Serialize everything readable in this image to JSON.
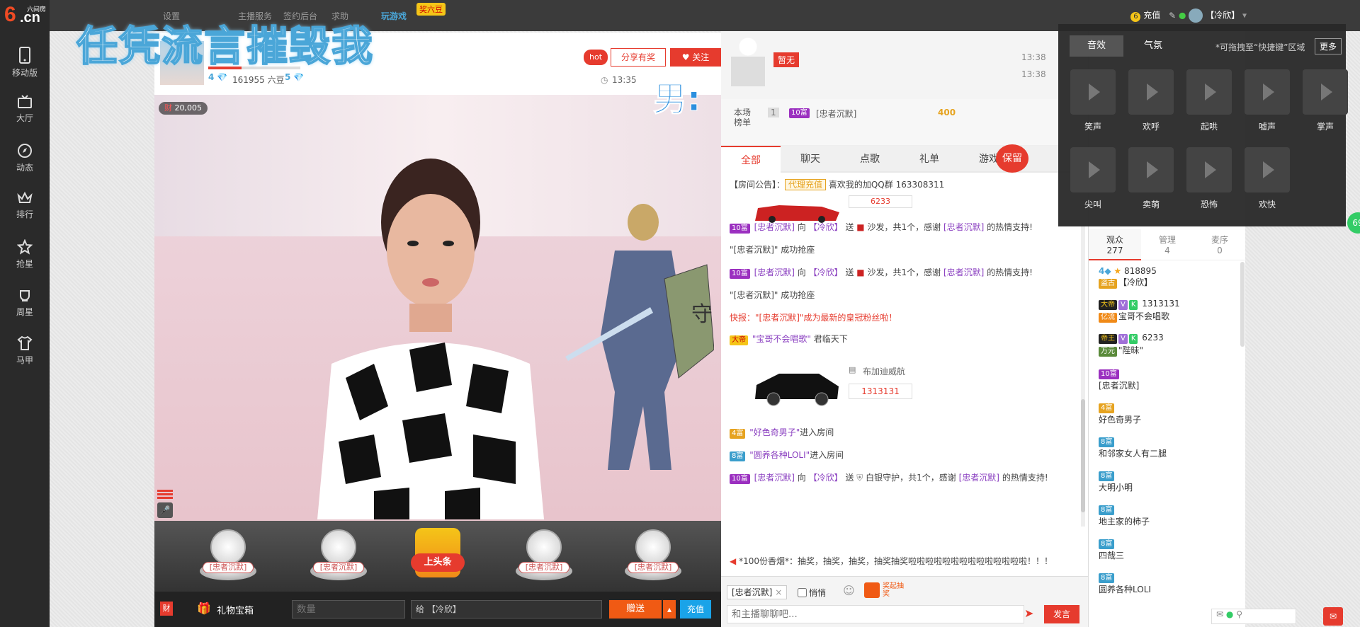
{
  "logo": {
    "brand": "6.cn",
    "tag": "六间房"
  },
  "sidebar": {
    "items": [
      {
        "label": "移动版",
        "icon": "mobile-icon"
      },
      {
        "label": "大厅",
        "icon": "tv-icon"
      },
      {
        "label": "动态",
        "icon": "compass-icon"
      },
      {
        "label": "排行",
        "icon": "crown-icon"
      },
      {
        "label": "抢星",
        "icon": "star-icon"
      },
      {
        "label": "周星",
        "icon": "cup-icon"
      },
      {
        "label": "马甲",
        "icon": "shirt-icon"
      }
    ]
  },
  "topbar": {
    "links": [
      "设置",
      "主播服务",
      "签约后台",
      "求助"
    ],
    "game": "玩游戏",
    "game_badge": "奖六豆",
    "recharge": "充值",
    "username": "【冷欣】"
  },
  "overlay": {
    "big_text": "任凭流言摧毁我",
    "side_text": "男:"
  },
  "streamer": {
    "beans": "161955 六豆",
    "level": "4",
    "rank_level": "5",
    "hot": "hot",
    "share": "分享有奖",
    "follow": "关注",
    "time": "13:35",
    "wealth": "20,005"
  },
  "gifts": {
    "items": [
      "[忠者沉默]",
      "[忠者沉默]",
      "上头条",
      "[忠者沉默]",
      "[忠者沉默]"
    ]
  },
  "bottombar": {
    "box": "礼物宝箱",
    "qty_placeholder": "数量",
    "to": "给 【冷欣】",
    "send": "赠送",
    "recharge": "充值",
    "wealth_btn": "财"
  },
  "center": {
    "guard_label": "暂无",
    "time1": "13:38",
    "time2": "13:38",
    "rank_label": "本场榜单",
    "rank_no": "1",
    "rank_lv": "10富",
    "rank_user": "[忠者沉默]",
    "rank_score": "400",
    "tabs": [
      "全部",
      "聊天",
      "点歌",
      "礼单",
      "游戏"
    ],
    "keep": "保留",
    "announce_label": "【房间公告】：",
    "agent": "代理充值",
    "announce_text": "喜欢我的加QQ群 163308311",
    "car_top_num": "6233",
    "messages": [
      {
        "lv": "10富",
        "user": "[忠者沉默]",
        "mid": "向",
        "to": "【冷欣】",
        "action": "送",
        "gift": "沙发，共1个，感谢",
        "thank_user": "[忠者沉默]",
        "end": "的热情支持!"
      },
      {
        "text": "\"[忠者沉默]\" 成功抢座"
      },
      {
        "lv": "10富",
        "user": "[忠者沉默]",
        "mid": "向",
        "to": "【冷欣】",
        "action": "送",
        "gift": "沙发，共1个，感谢",
        "thank_user": "[忠者沉默]",
        "end": "的热情支持!"
      },
      {
        "text": "\"[忠者沉默]\" 成功抢座"
      },
      {
        "text": "快报：\"[忠者沉默]\"成为最新的皇冠粉丝啦！"
      },
      {
        "badge": "大帝",
        "user": "\"宝哥不会唱歌\"",
        "end": "君临天下"
      },
      {
        "car_name": "布加迪威航",
        "car_num": "1313131"
      },
      {
        "lv": "4富",
        "user": "\"好色奇男子\"",
        "end": "进入房间"
      },
      {
        "lv": "8富",
        "user": "\"圆养各种LOLI\"",
        "end": "进入房间"
      },
      {
        "lv": "10富",
        "user": "[忠者沉默]",
        "mid": "向",
        "to": "【冷欣】",
        "action": "送",
        "gift": "白银守护，共1个，感谢",
        "thank_user": "[忠者沉默]",
        "end": "的热情支持!"
      }
    ],
    "broadcast": "*100份香烟*：抽奖，抽奖，抽奖，抽奖抽奖啦啦啦啦啦啦啦啦啦啦啦啦啦啦！！！",
    "chat_target": "[忠者沉默]",
    "private_label": "悄悄",
    "lottery": "奖起抽奖",
    "chat_placeholder": "和主播聊聊吧...",
    "send": "发言"
  },
  "audience": {
    "tabs": [
      {
        "label": "观众",
        "count": "277"
      },
      {
        "label": "管理",
        "count": "4"
      },
      {
        "label": "麦序",
        "count": "0"
      }
    ],
    "users": [
      {
        "badge": "4",
        "num": "818895",
        "name": "【冷欣】",
        "tag": "盗古"
      },
      {
        "badge": "大帝",
        "num": "1313131",
        "name": "宝哥不会唱歌",
        "tag": "亿流"
      },
      {
        "badge": "帝王",
        "num": "6233",
        "name": "\"陛昧\"",
        "tag": "万元"
      },
      {
        "badge": "10富",
        "num": "",
        "name": "[忠者沉默]"
      },
      {
        "badge": "4富",
        "num": "",
        "name": "好色奇男子"
      },
      {
        "badge": "8富",
        "num": "",
        "name": "和邻家女人有二腿"
      },
      {
        "badge": "8富",
        "num": "",
        "name": "大明小明"
      },
      {
        "badge": "8富",
        "num": "",
        "name": "地主家的柿子"
      },
      {
        "badge": "8富",
        "num": "",
        "name": "四哉三"
      },
      {
        "badge": "8富",
        "num": "",
        "name": "圆养各种LOLI"
      }
    ],
    "counter": "69"
  },
  "sound_popup": {
    "tabs": [
      "音效",
      "气氛"
    ],
    "hint": "*可拖拽至“快捷键”区域",
    "more": "更多",
    "sounds": [
      "笑声",
      "欢呼",
      "起哄",
      "嘘声",
      "掌声",
      "尖叫",
      "卖萌",
      "恐怖",
      "欢快"
    ]
  },
  "colors": {
    "accent": "#e63b2e",
    "topbar": "#3b3b3b",
    "sidebar": "#2a2a2a"
  }
}
